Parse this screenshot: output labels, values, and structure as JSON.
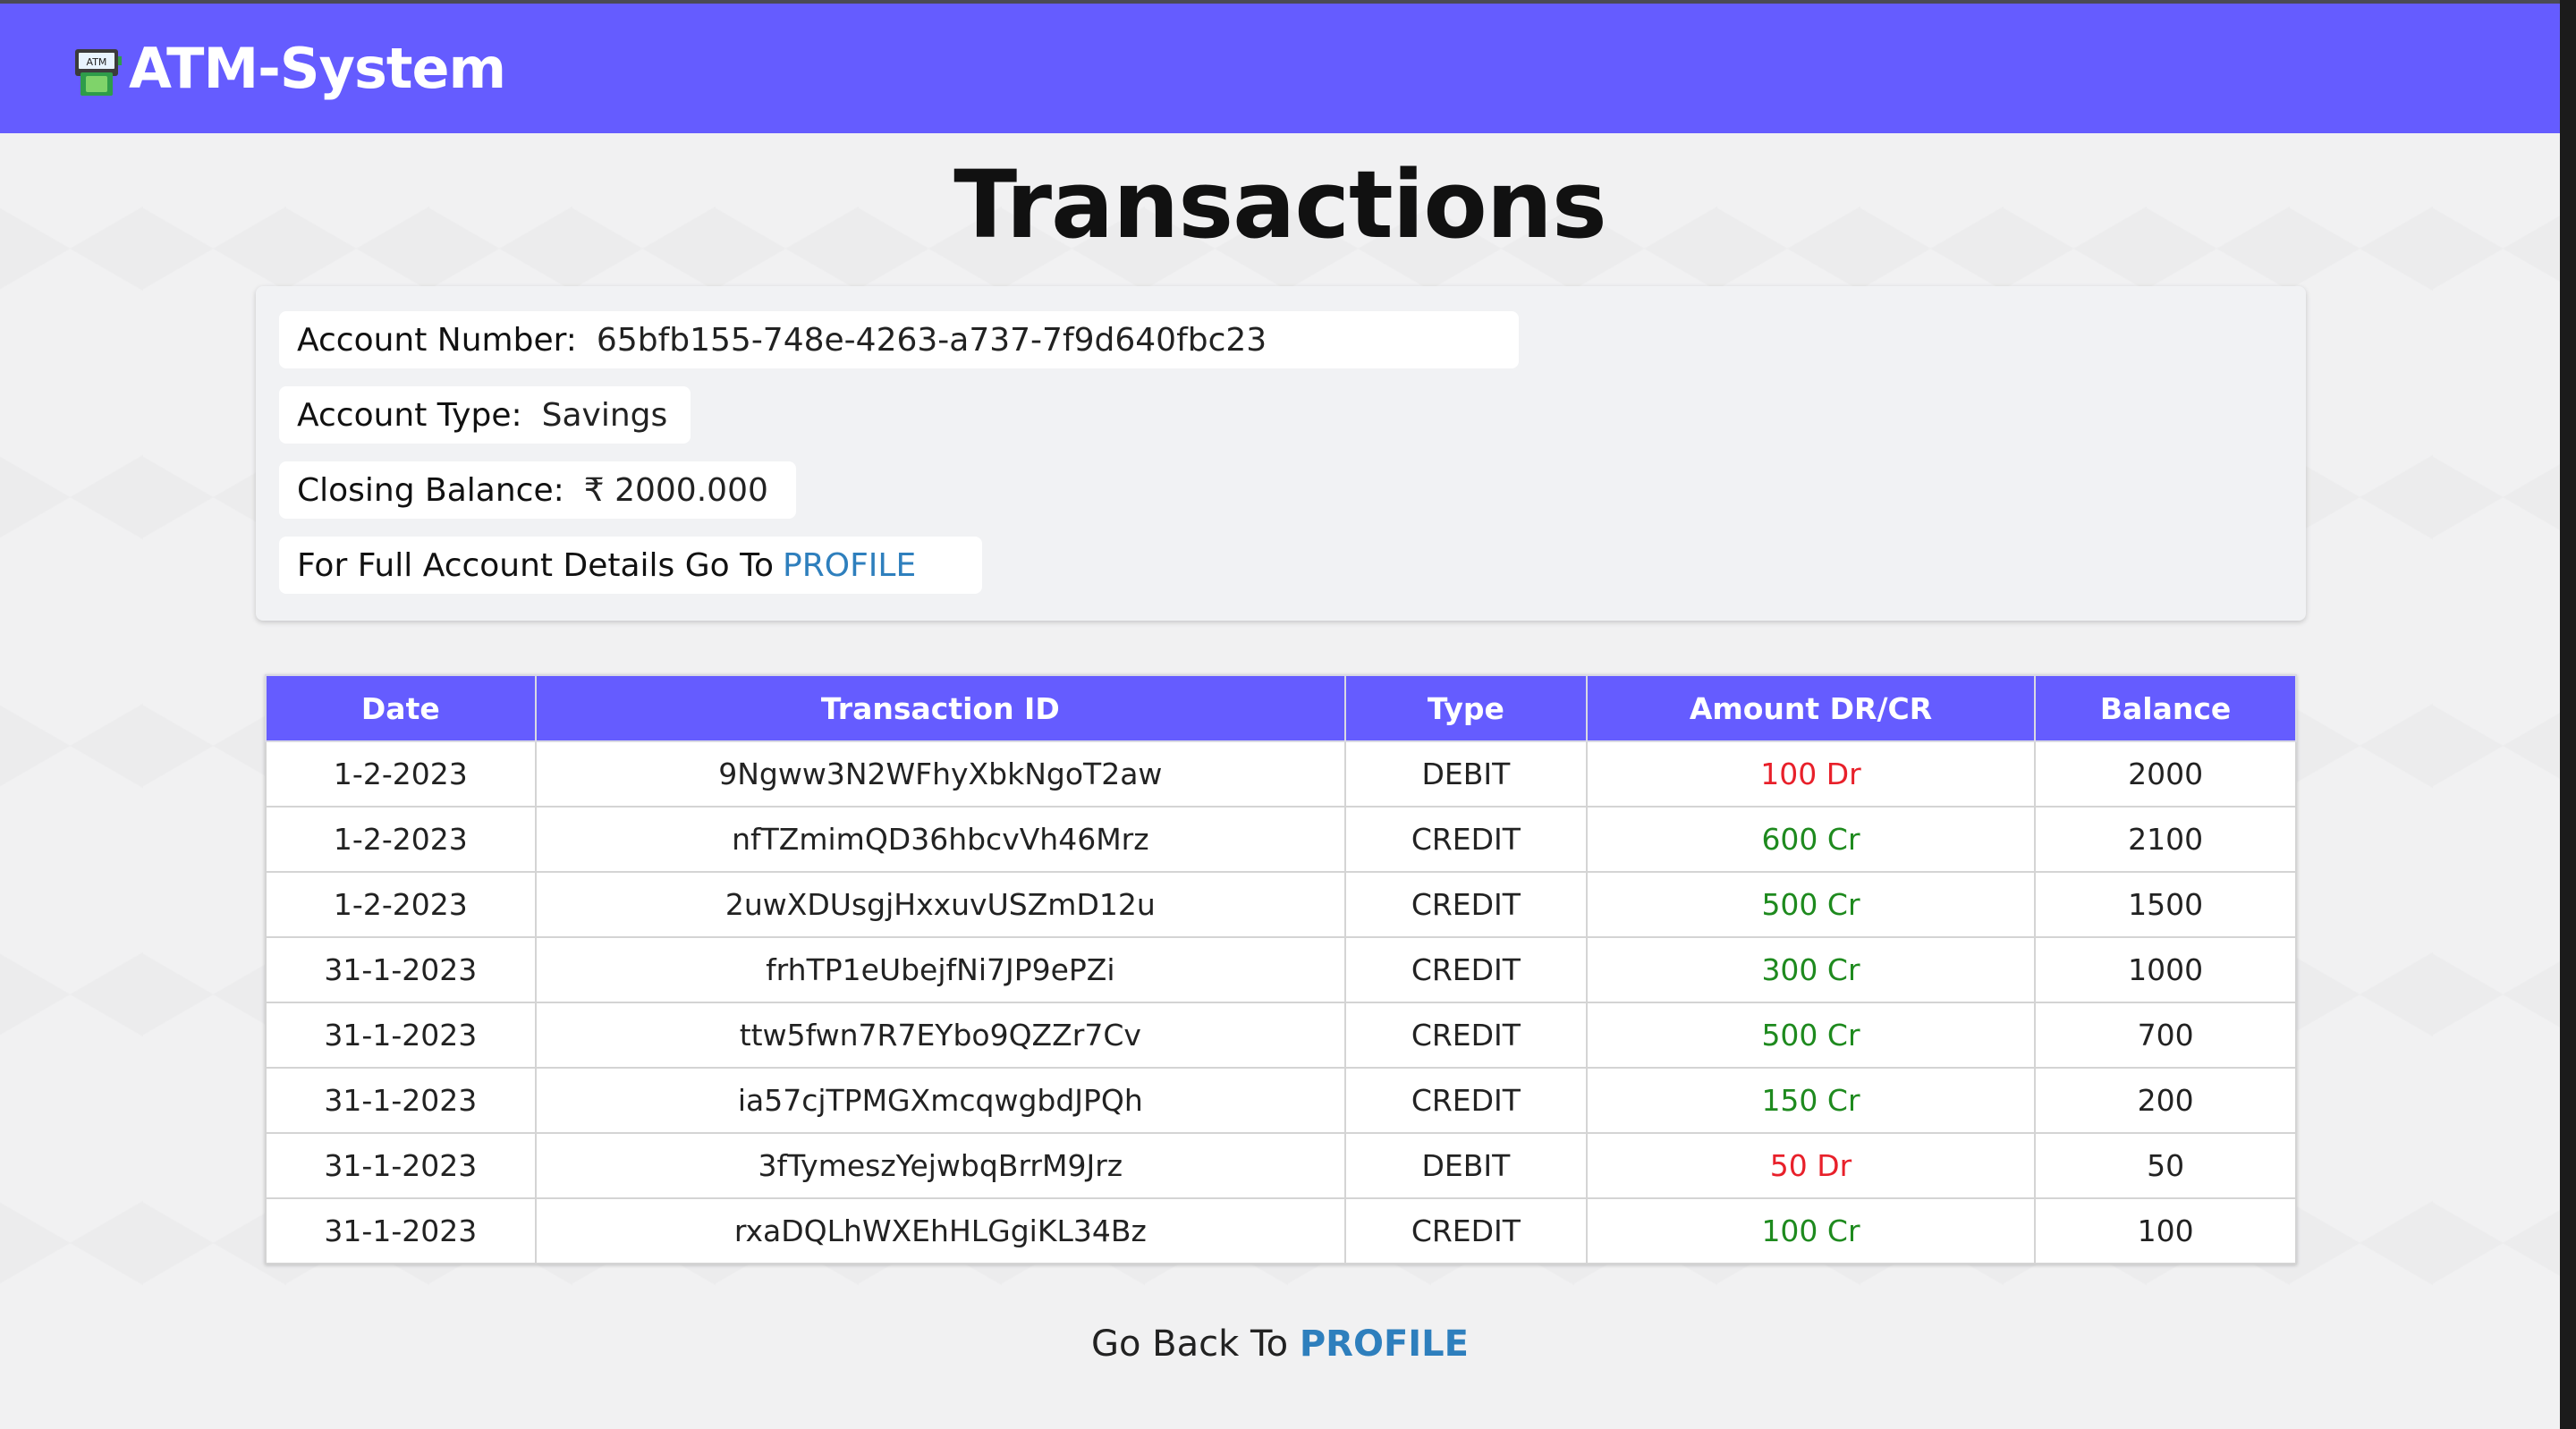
{
  "header": {
    "icon_text": "ATM",
    "brand": "ATM-System"
  },
  "page_title": "Transactions",
  "account": {
    "number_label": "Account Number:",
    "number_value": "65bfb155-748e-4263-a737-7f9d640fbc23",
    "type_label": "Account Type:",
    "type_value": "Savings",
    "balance_label": "Closing Balance:",
    "balance_value": "₹ 2000.000",
    "details_text": "For Full Account Details Go To",
    "details_link": "PROFILE"
  },
  "table": {
    "headers": [
      "Date",
      "Transaction ID",
      "Type",
      "Amount DR/CR",
      "Balance"
    ],
    "rows": [
      {
        "date": "1-2-2023",
        "id": "9Ngww3N2WFhyXbkNgoT2aw",
        "type": "DEBIT",
        "amount": "100 Dr",
        "kind": "dr",
        "balance": "2000"
      },
      {
        "date": "1-2-2023",
        "id": "nfTZmimQD36hbcvVh46Mrz",
        "type": "CREDIT",
        "amount": "600 Cr",
        "kind": "cr",
        "balance": "2100"
      },
      {
        "date": "1-2-2023",
        "id": "2uwXDUsgjHxxuvUSZmD12u",
        "type": "CREDIT",
        "amount": "500 Cr",
        "kind": "cr",
        "balance": "1500"
      },
      {
        "date": "31-1-2023",
        "id": "frhTP1eUbejfNi7JP9ePZi",
        "type": "CREDIT",
        "amount": "300 Cr",
        "kind": "cr",
        "balance": "1000"
      },
      {
        "date": "31-1-2023",
        "id": "ttw5fwn7R7EYbo9QZZr7Cv",
        "type": "CREDIT",
        "amount": "500 Cr",
        "kind": "cr",
        "balance": "700"
      },
      {
        "date": "31-1-2023",
        "id": "ia57cjTPMGXmcqwgbdJPQh",
        "type": "CREDIT",
        "amount": "150 Cr",
        "kind": "cr",
        "balance": "200"
      },
      {
        "date": "31-1-2023",
        "id": "3fTymeszYejwbqBrrM9Jrz",
        "type": "DEBIT",
        "amount": "50 Dr",
        "kind": "dr",
        "balance": "50"
      },
      {
        "date": "31-1-2023",
        "id": "rxaDQLhWXEhHLGgiKL34Bz",
        "type": "CREDIT",
        "amount": "100 Cr",
        "kind": "cr",
        "balance": "100"
      }
    ]
  },
  "footer": {
    "text": "Go Back To",
    "link": "PROFILE"
  },
  "colors": {
    "brand": "#655cff",
    "link": "#2e7fbd",
    "debit": "#e8202a",
    "credit": "#1e8a1e"
  }
}
